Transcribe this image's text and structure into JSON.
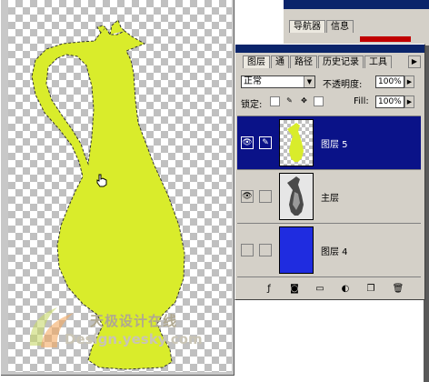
{
  "navigator_panel": {
    "tabs": [
      {
        "label": "导航器",
        "active": true
      },
      {
        "label": "信息",
        "active": false
      }
    ]
  },
  "layers_panel": {
    "tabs": [
      {
        "label": "图层",
        "active": true
      },
      {
        "label": "通",
        "active": false
      },
      {
        "label": "路径",
        "active": false
      },
      {
        "label": "历史记录",
        "active": false
      },
      {
        "label": "工具",
        "active": false
      }
    ],
    "blend_mode": "正常",
    "opacity_label": "不透明度:",
    "opacity_value": "100%",
    "lock_label": "锁定:",
    "fill_label": "Fill:",
    "fill_value": "100%",
    "layers": [
      {
        "name": "图层 5",
        "visible": true,
        "selected": true,
        "thumbnail": "yellow-vase-silhouette"
      },
      {
        "name": "主层",
        "visible": true,
        "selected": false,
        "thumbnail": "gray-vase-photo"
      },
      {
        "name": "图层 4",
        "visible": false,
        "selected": false,
        "thumbnail": "solid-blue"
      }
    ],
    "footer_icons": [
      "layer-style-icon",
      "add-mask-icon",
      "new-group-icon",
      "adjustment-layer-icon",
      "new-layer-icon",
      "trash-icon"
    ]
  },
  "watermark": {
    "text_cn": "天极设计在线",
    "text_en": "Design.yesky.com"
  },
  "colors": {
    "vase_fill": "#d9ec2b",
    "selected_layer_bg": "#0a1288",
    "layer_blue": "#1f2ce0",
    "panel_bg": "#d4d0c8",
    "title_bar": "#0a246a"
  }
}
